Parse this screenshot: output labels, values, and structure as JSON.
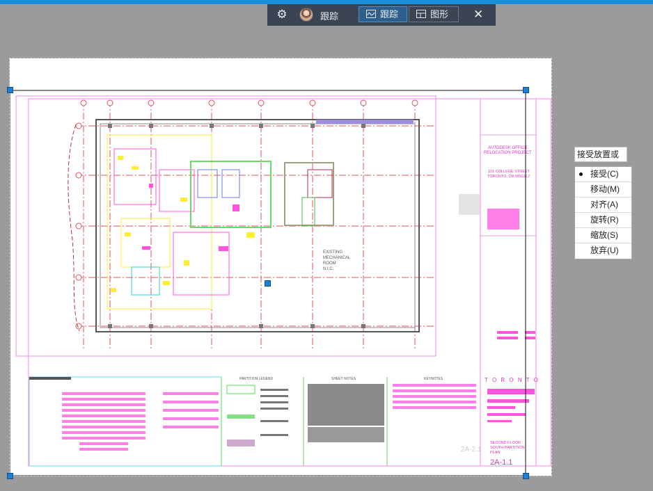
{
  "toolbar": {
    "settings_icon": "gear-icon",
    "user_label": "跟踪",
    "tab_track_label": "跟踪",
    "tab_shape_label": "图形",
    "close_icon": "close-icon"
  },
  "drawing": {
    "project_title_lines": [
      "AUTODESK OFFICE",
      "RELOCATION PROJECT"
    ],
    "address_lines": [
      "101 COLLEGE STREET",
      "TORONTO, ON M5G1L7"
    ],
    "room_label_lines": [
      "EXISTING",
      "MECHANICAL",
      "ROOM",
      "N.I.C."
    ],
    "legend_headings": [
      "PARTITION LEGEND",
      "SHEET NOTES",
      "KEYNOTES"
    ],
    "city_logo": "T O R O N T O",
    "sheet_title_lines": [
      "SECOND FLOOR",
      "SOUTH PARTITION",
      "PLAN"
    ],
    "sheet_number": "2A-1.1",
    "sheet_number_ghost": "2A-2.1"
  },
  "command_prompt": "接受放置或",
  "context_menu": {
    "items": [
      {
        "label": "接受(C)",
        "selected": true
      },
      {
        "label": "移动(M)",
        "selected": false
      },
      {
        "label": "对齐(A)",
        "selected": false
      },
      {
        "label": "旋转(R)",
        "selected": false
      },
      {
        "label": "缩放(S)",
        "selected": false
      },
      {
        "label": "放弃(U)",
        "selected": false
      }
    ]
  },
  "colors": {
    "accent": "#1a8fd8",
    "toolbar_bg": "#3b4453",
    "canvas_bg": "#9b9b9b",
    "cad_red": "#e0505a",
    "cad_magenta": "#ff4fd8",
    "cad_yellow": "#ffee33",
    "cad_green": "#55dd55"
  }
}
